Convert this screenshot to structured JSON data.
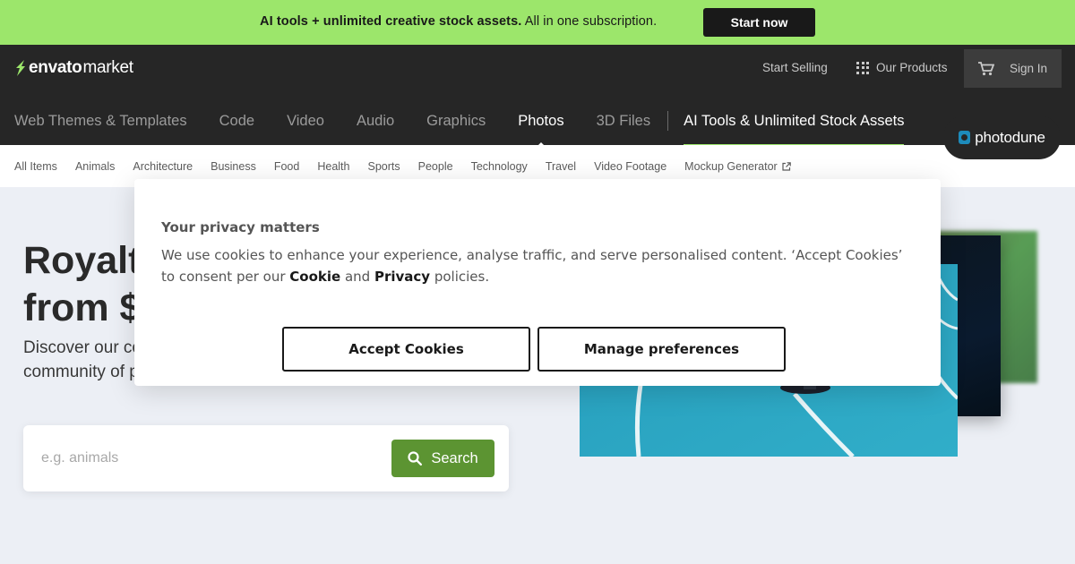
{
  "promo": {
    "bold_text": "AI tools + unlimited creative stock assets.",
    "text": " All in one subscription.",
    "button": "Start now"
  },
  "header": {
    "logo_bold": "envato",
    "logo_light": "market",
    "start_selling": "Start Selling",
    "our_products": "Our Products",
    "sign_in": "Sign In"
  },
  "categories": [
    "Web Themes & Templates",
    "Code",
    "Video",
    "Audio",
    "Graphics",
    "Photos",
    "3D Files",
    "AI Tools & Unlimited Stock Assets"
  ],
  "active_category": "Photos",
  "badge": "photodune",
  "subnav": [
    "All Items",
    "Animals",
    "Architecture",
    "Business",
    "Food",
    "Health",
    "Sports",
    "People",
    "Technology",
    "Travel",
    "Video Footage",
    "Mockup Generator"
  ],
  "hero": {
    "title_line1": "Royalt",
    "title_line2": "from $",
    "sub_line1": "Discover our co",
    "sub_line2": "community of p"
  },
  "search": {
    "placeholder": "e.g. animals",
    "button": "Search"
  },
  "cookie": {
    "title": "Your privacy matters",
    "body_start": "We use cookies to enhance your experience, analyse traffic, and serve personalised content. ‘Accept Cookies’ to consent per our ",
    "cookie_link": "Cookie",
    "and_text": " and ",
    "privacy_link": "Privacy",
    "body_end": " policies.",
    "accept": "Accept Cookies",
    "manage": "Manage preferences"
  },
  "colors": {
    "promo_bg": "#9ce66b",
    "header_bg": "#262626",
    "search_button": "#5c9432",
    "accent": "#9ce66b"
  },
  "icons": [
    "envato-leaf-icon",
    "grid-icon",
    "cart-icon",
    "photodune-icon",
    "external-link-icon",
    "search-icon"
  ]
}
